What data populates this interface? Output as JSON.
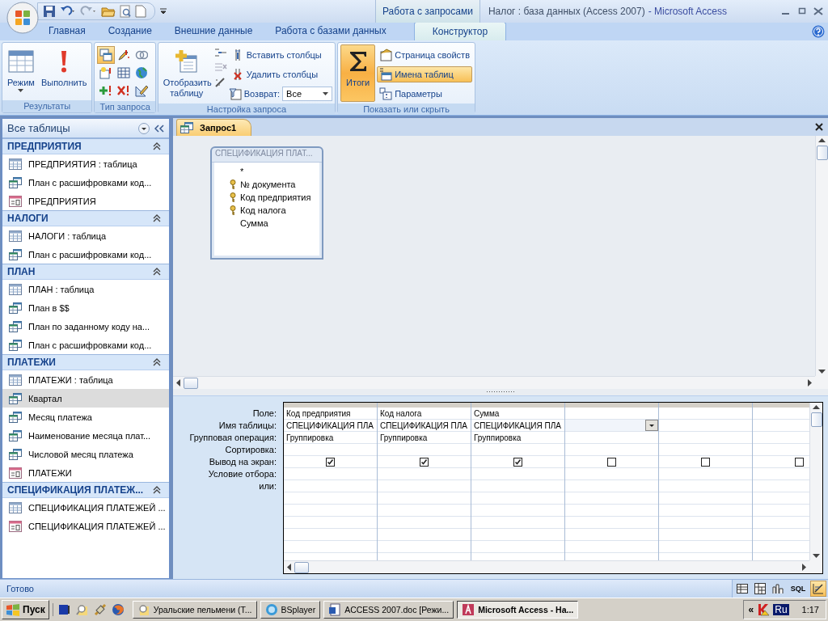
{
  "title_bar": {
    "context_label": "Работа с запросами",
    "title": "Налог : база данных (Access 2007)",
    "app": "- Microsoft Access"
  },
  "ribbon_tabs": [
    {
      "label": "Главная",
      "selected": false
    },
    {
      "label": "Создание",
      "selected": false
    },
    {
      "label": "Внешние данные",
      "selected": false
    },
    {
      "label": "Работа с базами данных",
      "selected": false
    },
    {
      "label": "Конструктор",
      "selected": true
    }
  ],
  "results_group": {
    "label": "Результаты",
    "buttons": [
      {
        "label": "Режим",
        "dropdown": true
      },
      {
        "label": "Выполнить",
        "dropdown": false
      }
    ]
  },
  "query_type_group": {
    "label": "Тип запроса",
    "buttons": [
      {
        "selected": true
      },
      {
        "selected": false
      },
      {
        "selected": false
      },
      {
        "selected": false
      },
      {
        "selected": false
      },
      {
        "selected": false
      },
      {
        "selected": false
      },
      {
        "selected": false
      },
      {
        "selected": false
      }
    ]
  },
  "query_setup_group": {
    "label": "Настройка запроса",
    "show_table": "Отобразить таблицу",
    "commands": [
      {
        "label": "Вставить столбцы"
      },
      {
        "label": "Удалить столбцы"
      }
    ],
    "return_label": "Возврат:",
    "return_value": "Все"
  },
  "show_hide_group": {
    "label": "Показать или скрыть",
    "totals": {
      "label": "Итоги",
      "selected": true
    },
    "commands": [
      {
        "label": "Страница свойств",
        "selected": false
      },
      {
        "label": "Имена таблиц",
        "selected": true
      },
      {
        "label": "Параметры",
        "selected": false
      }
    ]
  },
  "nav_pane": {
    "title": "Все таблицы",
    "groups": [
      {
        "label": "ПРЕДПРИЯТИЯ",
        "expanded": true,
        "items": [
          {
            "kind": "table",
            "label": "ПРЕДПРИЯТИЯ : таблица",
            "selected": false
          },
          {
            "kind": "query",
            "label": "План с расшифровками код...",
            "selected": false
          },
          {
            "kind": "form",
            "label": "ПРЕДПРИЯТИЯ",
            "selected": false
          }
        ]
      },
      {
        "label": "НАЛОГИ",
        "expanded": true,
        "items": [
          {
            "kind": "table",
            "label": "НАЛОГИ : таблица",
            "selected": false
          },
          {
            "kind": "query",
            "label": "План с расшифровками код...",
            "selected": false
          }
        ]
      },
      {
        "label": "ПЛАН",
        "expanded": true,
        "items": [
          {
            "kind": "table",
            "label": "ПЛАН : таблица",
            "selected": false
          },
          {
            "kind": "query",
            "label": "План в $$",
            "selected": false
          },
          {
            "kind": "query",
            "label": "План по заданному коду на...",
            "selected": false
          },
          {
            "kind": "query",
            "label": "План с расшифровками код...",
            "selected": false
          }
        ]
      },
      {
        "label": "ПЛАТЕЖИ",
        "expanded": true,
        "items": [
          {
            "kind": "table",
            "label": "ПЛАТЕЖИ : таблица",
            "selected": false
          },
          {
            "kind": "query",
            "label": "Квартал",
            "selected": true
          },
          {
            "kind": "query",
            "label": "Месяц платежа",
            "selected": false
          },
          {
            "kind": "query",
            "label": "Наименование месяца плат...",
            "selected": false
          },
          {
            "kind": "query",
            "label": "Числовой месяц платежа",
            "selected": false
          },
          {
            "kind": "form",
            "label": "ПЛАТЕЖИ",
            "selected": false
          }
        ]
      },
      {
        "label": "СПЕЦИФИКАЦИЯ ПЛАТЕЖ...",
        "expanded": true,
        "items": [
          {
            "kind": "table",
            "label": "СПЕЦИФИКАЦИЯ ПЛАТЕЖЕЙ ...",
            "selected": false
          },
          {
            "kind": "form",
            "label": "СПЕЦИФИКАЦИЯ ПЛАТЕЖЕЙ ...",
            "selected": false
          }
        ]
      }
    ]
  },
  "document_tab": {
    "label": "Запрос1"
  },
  "field_list": {
    "title": "СПЕЦИФИКАЦИЯ ПЛАТ...",
    "fields": [
      {
        "name": "*",
        "key": false
      },
      {
        "name": "№ документа",
        "key": true
      },
      {
        "name": "Код предприятия",
        "key": true
      },
      {
        "name": "Код налога",
        "key": true
      },
      {
        "name": "Сумма",
        "key": false
      }
    ]
  },
  "design_grid": {
    "row_labels": [
      "Поле:",
      "Имя таблицы:",
      "Групповая операция:",
      "Сортировка:",
      "Вывод на экран:",
      "Условие отбора:",
      "или:"
    ],
    "columns": [
      {
        "field": "Код предприятия",
        "table": "СПЕЦИФИКАЦИЯ ПЛА",
        "total": "Группировка",
        "show": true,
        "active": false
      },
      {
        "field": "Код налога",
        "table": "СПЕЦИФИКАЦИЯ ПЛА",
        "total": "Группировка",
        "show": true,
        "active": false
      },
      {
        "field": "Сумма",
        "table": "СПЕЦИФИКАЦИЯ ПЛА",
        "total": "Группировка",
        "show": true,
        "active": false
      },
      {
        "show": false,
        "active": true
      },
      {
        "show": false,
        "active": false
      },
      {
        "show": false,
        "active": false
      }
    ]
  },
  "status_bar": {
    "text": "Готово",
    "views": [
      {
        "selected": false
      },
      {
        "selected": false
      },
      {
        "selected": false
      },
      {
        "label": "SQL",
        "selected": false
      },
      {
        "selected": true
      }
    ]
  },
  "taskbar": {
    "start": "Пуск",
    "tasks": [
      {
        "label": "Уральские пельмени (Т...",
        "selected": false
      },
      {
        "label": "BSplayer",
        "selected": false
      },
      {
        "label": "ACCESS 2007.doc [Режи...",
        "selected": false
      },
      {
        "label": "Microsoft Access - На...",
        "selected": true
      }
    ],
    "tray_toggle": "«",
    "language": "Ru",
    "clock": "1:17"
  }
}
